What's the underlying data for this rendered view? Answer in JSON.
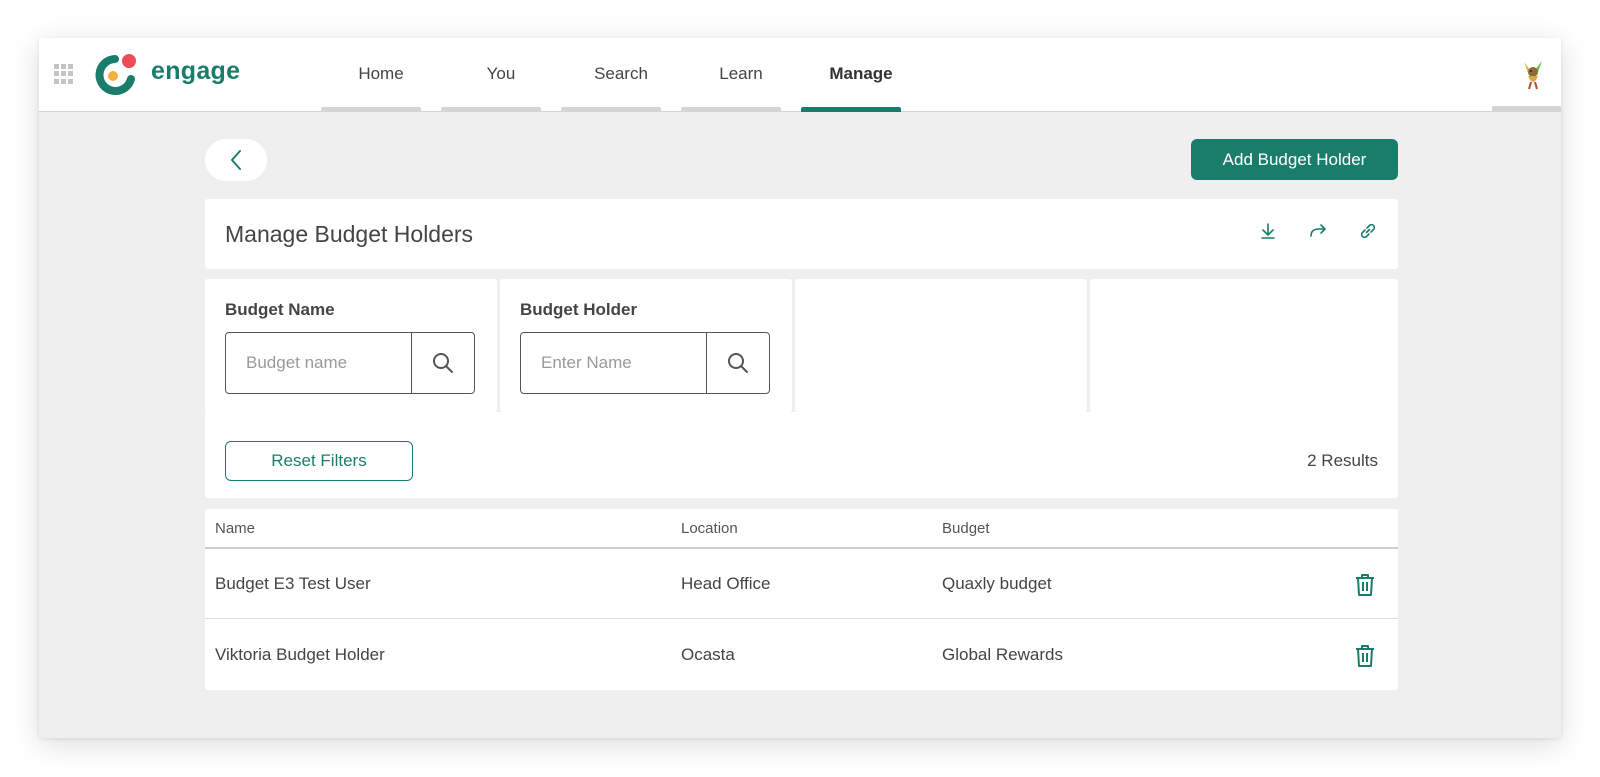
{
  "app": {
    "brand": "engage",
    "accent_color": "#1a7d6b",
    "logo_dot_color": "#ef4b55"
  },
  "nav": {
    "items": [
      {
        "label": "Home",
        "active": false
      },
      {
        "label": "You",
        "active": false
      },
      {
        "label": "Search",
        "active": false
      },
      {
        "label": "Learn",
        "active": false
      },
      {
        "label": "Manage",
        "active": true
      }
    ]
  },
  "toolbar": {
    "back_icon": "chevron-left-icon",
    "add_label": "Add Budget Holder"
  },
  "page": {
    "title": "Manage Budget Holders",
    "actions": [
      "download-icon",
      "share-icon",
      "link-icon"
    ]
  },
  "filters": {
    "budget_name": {
      "label": "Budget Name",
      "placeholder": "Budget name",
      "value": ""
    },
    "budget_holder": {
      "label": "Budget Holder",
      "placeholder": "Enter Name",
      "value": ""
    },
    "reset_label": "Reset Filters",
    "results": "2 Results"
  },
  "table": {
    "headers": [
      "Name",
      "Location",
      "Budget"
    ],
    "rows": [
      {
        "name": "Budget E3 Test User",
        "location": "Head Office",
        "budget": "Quaxly budget"
      },
      {
        "name": "Viktoria Budget Holder",
        "location": "Ocasta",
        "budget": "Global Rewards"
      }
    ]
  }
}
